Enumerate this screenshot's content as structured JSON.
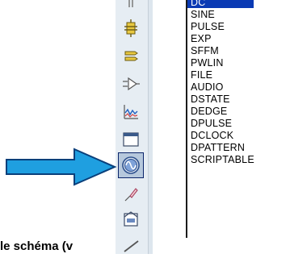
{
  "source_list": {
    "items": [
      "DC",
      "SINE",
      "PULSE",
      "EXP",
      "SFFM",
      "PWLIN",
      "FILE",
      "AUDIO",
      "DSTATE",
      "DEDGE",
      "DPULSE",
      "DCLOCK",
      "DPATTERN",
      "SCRIPTABLE"
    ],
    "selected": "DC"
  },
  "toolbar": {
    "icons": [
      "terminal-icon",
      "subcircuit-icon",
      "bus-icon",
      "probe-icon",
      "graph-icon",
      "tape-icon",
      "generator-icon",
      "voltage-probe-icon",
      "virtual-instrument-icon",
      "line-icon"
    ],
    "active": "generator-icon"
  },
  "caption": {
    "text": "le schéma (v"
  },
  "colors": {
    "selection": "#0a3ab4",
    "arrow_fill": "#1f9fe0",
    "arrow_stroke": "#0a3f7a",
    "toolbar_bg": "#e6edf3"
  }
}
